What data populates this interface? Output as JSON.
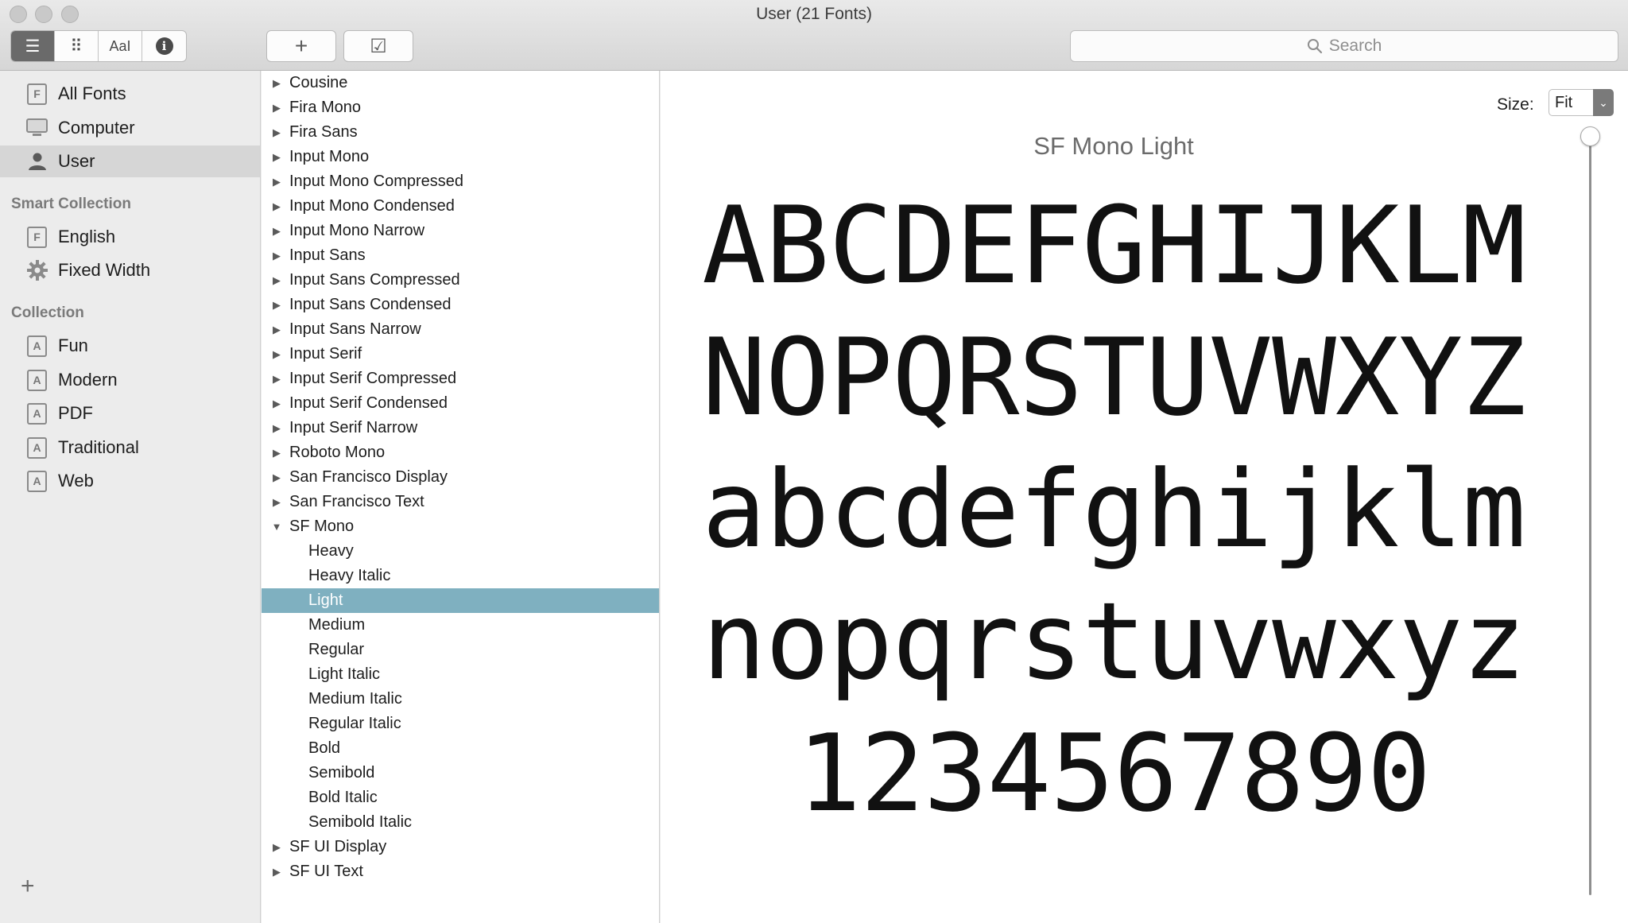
{
  "window": {
    "title": "User (21 Fonts)"
  },
  "toolbar": {
    "view_buttons": [
      {
        "name": "list-view",
        "icon": "list-icon",
        "glyph": "☰"
      },
      {
        "name": "grid-view",
        "icon": "grid-icon",
        "glyph": "⠿"
      },
      {
        "name": "sample-view",
        "icon": "sample-text-icon",
        "glyph": "AaI"
      },
      {
        "name": "info-view",
        "icon": "info-icon",
        "glyph": "i"
      }
    ],
    "add_glyph": "+",
    "validate_glyph": "☑",
    "search_placeholder": "Search"
  },
  "sidebar": {
    "library_items": [
      {
        "label": "All Fonts",
        "icon": "font-box-icon"
      },
      {
        "label": "Computer",
        "icon": "computer-icon"
      },
      {
        "label": "User",
        "icon": "user-icon",
        "selected": true
      }
    ],
    "smart_header": "Smart Collection",
    "smart_items": [
      {
        "label": "English",
        "icon": "font-box-icon"
      },
      {
        "label": "Fixed Width",
        "icon": "gear-icon"
      }
    ],
    "collection_header": "Collection",
    "collection_items": [
      {
        "label": "Fun",
        "icon": "collection-icon"
      },
      {
        "label": "Modern",
        "icon": "collection-icon"
      },
      {
        "label": "PDF",
        "icon": "collection-icon"
      },
      {
        "label": "Traditional",
        "icon": "collection-icon"
      },
      {
        "label": "Web",
        "icon": "collection-icon"
      }
    ],
    "add_glyph": "+"
  },
  "font_list": {
    "families_before": [
      "Cousine",
      "Fira Mono",
      "Fira Sans",
      "Input Mono",
      "Input Mono Compressed",
      "Input Mono Condensed",
      "Input Mono Narrow",
      "Input Sans",
      "Input Sans Compressed",
      "Input Sans Condensed",
      "Input Sans Narrow",
      "Input Serif",
      "Input Serif Compressed",
      "Input Serif Condensed",
      "Input Serif Narrow",
      "Roboto Mono",
      "San Francisco Display",
      "San Francisco Text"
    ],
    "expanded_family": "SF Mono",
    "styles": [
      "Heavy",
      "Heavy Italic",
      "Light",
      "Medium",
      "Regular",
      "Light Italic",
      "Medium Italic",
      "Regular Italic",
      "Bold",
      "Semibold",
      "Bold Italic",
      "Semibold Italic"
    ],
    "selected_style": "Light",
    "families_after": [
      "SF UI Display",
      "SF UI Text"
    ]
  },
  "preview": {
    "size_label": "Size:",
    "size_value": "Fit",
    "font_title": "SF Mono Light",
    "lines": [
      "ABCDEFGHIJKLM",
      "NOPQRSTUVWXYZ",
      "abcdefghijklm",
      "nopqrstuvwxyz",
      "1234567890"
    ],
    "slider_fraction": 0.0
  },
  "colors": {
    "selection": "#7fb0c0",
    "sidebar_selection": "#d6d6d6"
  }
}
